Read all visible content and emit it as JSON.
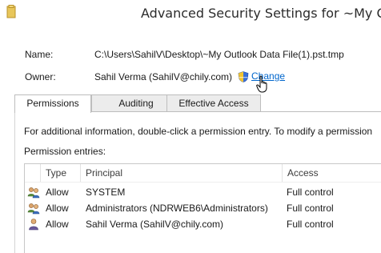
{
  "window": {
    "title": "Advanced Security Settings for ~My Outlook"
  },
  "fields": {
    "name_label": "Name:",
    "name_value": "C:\\Users\\SahilV\\Desktop\\~My Outlook Data File(1).pst.tmp",
    "owner_label": "Owner:",
    "owner_value": "Sahil Verma (SahilV@chily.com)",
    "change_link": "Change"
  },
  "tabs": [
    {
      "label": "Permissions",
      "active": true
    },
    {
      "label": "Auditing",
      "active": false
    },
    {
      "label": "Effective Access",
      "active": false
    }
  ],
  "permissions": {
    "info_text": "For additional information, double-click a permission entry. To modify a permission",
    "entries_label": "Permission entries:",
    "columns": [
      "Type",
      "Principal",
      "Access"
    ],
    "rows": [
      {
        "icon": "group-users-icon",
        "type": "Allow",
        "principal": "SYSTEM",
        "access": "Full control"
      },
      {
        "icon": "group-users-icon",
        "type": "Allow",
        "principal": "Administrators (NDRWEB6\\Administrators)",
        "access": "Full control"
      },
      {
        "icon": "single-user-icon",
        "type": "Allow",
        "principal": "Sahil Verma (SahilV@chily.com)",
        "access": "Full control"
      }
    ]
  },
  "colors": {
    "link": "#0066cc",
    "tab_inactive": "#ececec",
    "border": "#bdbdbd"
  }
}
